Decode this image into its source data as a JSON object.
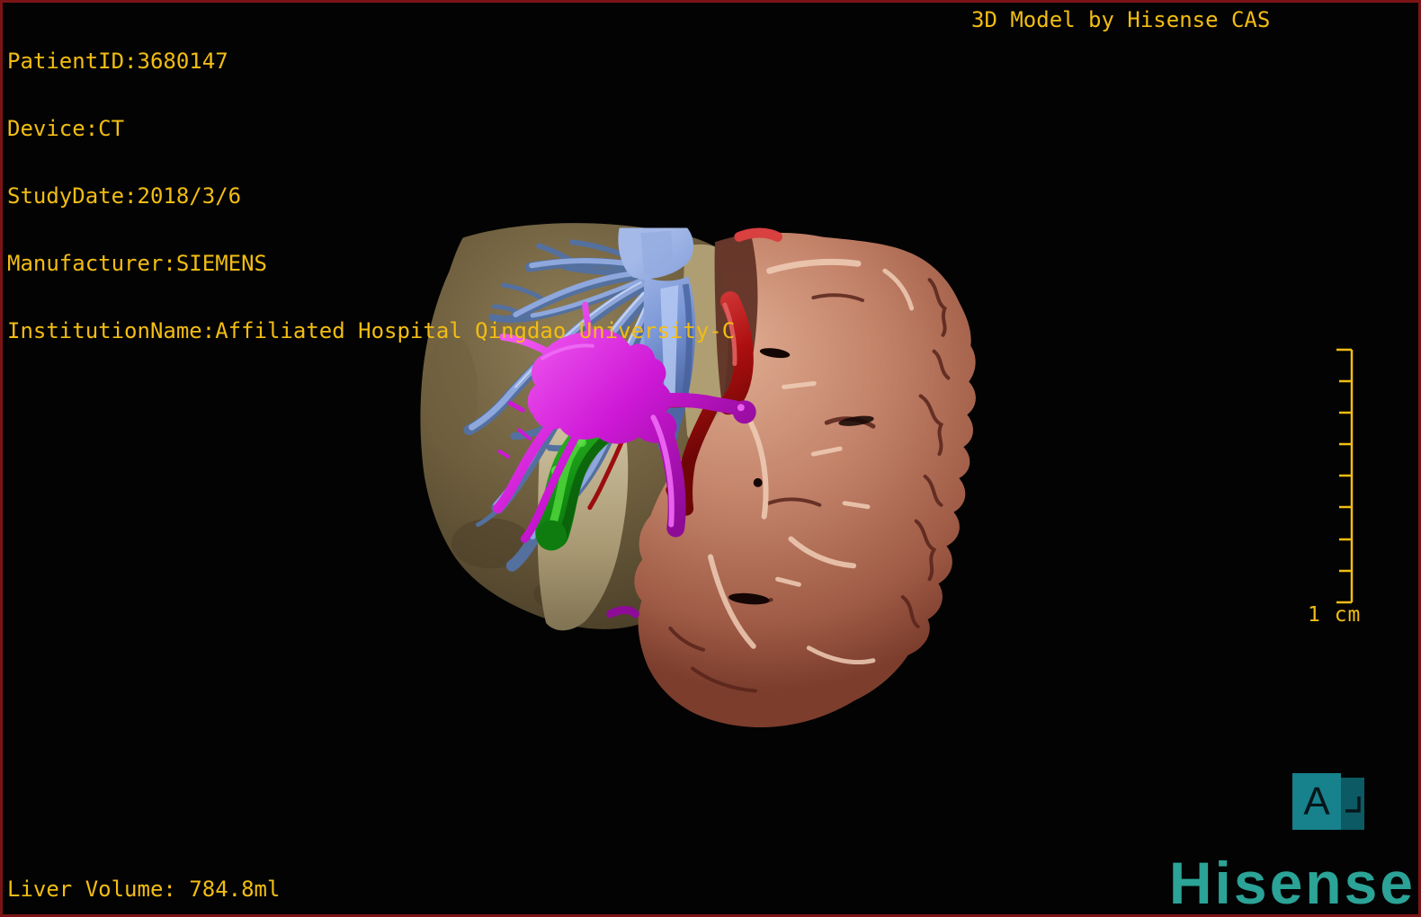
{
  "header": {
    "patient_info": [
      "PatientID:3680147",
      "Device:CT",
      "StudyDate:2018/3/6",
      "Manufacturer:SIEMENS",
      "InstitutionName:Affiliated Hospital Qingdao University-C"
    ],
    "watermark_title": "3D Model by Hisense CAS"
  },
  "viewport": {
    "scale_label": "1 cm",
    "scale_intervals": 8,
    "orientation_letter": "A",
    "structures": [
      {
        "name": "liver-shell",
        "color": "#8a7950"
      },
      {
        "name": "remnant-liver-lobe",
        "color": "#c08265"
      },
      {
        "name": "hepatic-vein-tree",
        "color": "#7b97d6"
      },
      {
        "name": "portal-vein",
        "color": "#ce18d6"
      },
      {
        "name": "hepatic-artery",
        "color": "#ad0f0f"
      },
      {
        "name": "gallbladder",
        "color": "#129112"
      }
    ]
  },
  "footer": {
    "liver_volume": "Liver Volume: 784.8ml",
    "logo_text": "Hisense"
  },
  "colors": {
    "overlay_text": "#f2bd13",
    "screen_border": "#7a1416",
    "logo": "#2ba396",
    "cube_front": "#17818c",
    "cube_side": "#0c5a63",
    "background": "#030303"
  }
}
